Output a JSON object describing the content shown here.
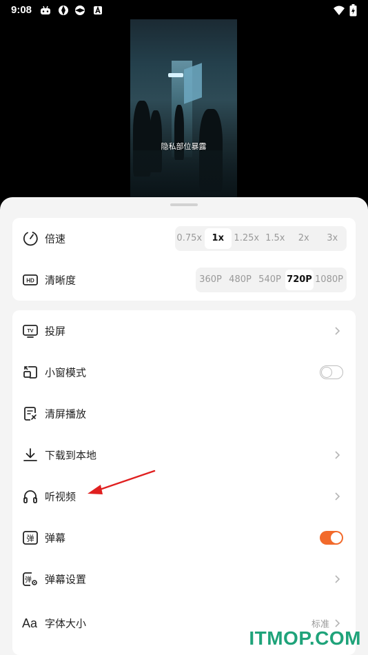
{
  "status_bar": {
    "time": "9:08"
  },
  "video": {
    "subtitle": "隐私部位暴露"
  },
  "playback": {
    "speed": {
      "label": "倍速",
      "options": [
        "0.75x",
        "1x",
        "1.25x",
        "1.5x",
        "2x",
        "3x"
      ],
      "selected": "1x"
    },
    "quality": {
      "label": "清晰度",
      "options": [
        "360P",
        "480P",
        "540P",
        "720P",
        "1080P"
      ],
      "selected": "720P"
    }
  },
  "menu": {
    "cast": {
      "label": "投屏"
    },
    "pip": {
      "label": "小窗模式",
      "enabled": false
    },
    "clear_screen": {
      "label": "清屏播放"
    },
    "download": {
      "label": "下载到本地"
    },
    "listen": {
      "label": "听视频"
    },
    "danmaku": {
      "label": "弹幕",
      "enabled": true
    },
    "danmaku_settings": {
      "label": "弹幕设置"
    },
    "font_size": {
      "label": "字体大小",
      "value": "标准"
    }
  },
  "watermark": "ITMOP.COM",
  "colors": {
    "accent": "#f26a2b",
    "watermark": "#1fa37a",
    "annotation_arrow": "#e02020"
  }
}
